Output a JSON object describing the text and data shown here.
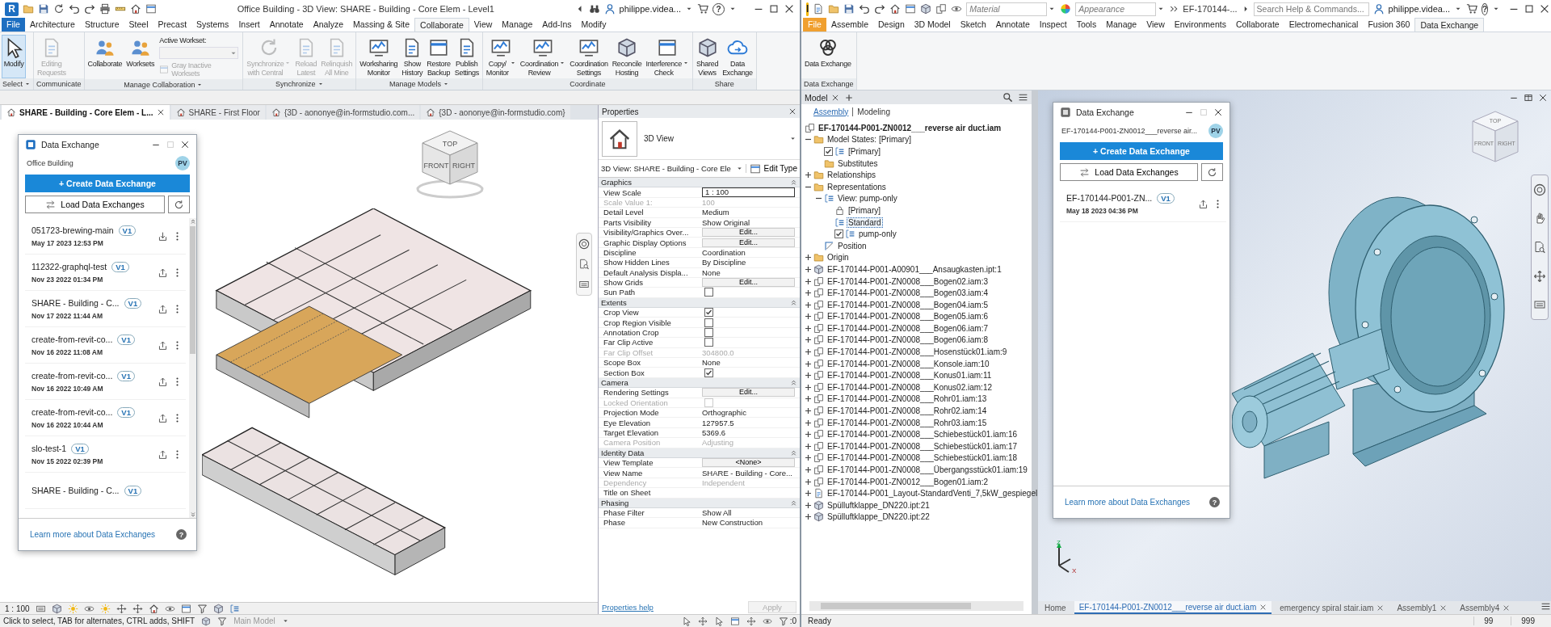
{
  "revit": {
    "logo": "R",
    "title": "Office Building - 3D View: SHARE - Building - Core Elem - Level1",
    "user": "philippe.videa...",
    "help_glyph": "?",
    "menu_tabs": [
      {
        "label": "File",
        "kind": "file",
        "selected": false
      },
      {
        "label": "Architecture",
        "kind": "tab",
        "selected": false
      },
      {
        "label": "Structure",
        "kind": "tab",
        "selected": false
      },
      {
        "label": "Steel",
        "kind": "tab",
        "selected": false
      },
      {
        "label": "Precast",
        "kind": "tab",
        "selected": false
      },
      {
        "label": "Systems",
        "kind": "tab",
        "selected": false
      },
      {
        "label": "Insert",
        "kind": "tab",
        "selected": false
      },
      {
        "label": "Annotate",
        "kind": "tab",
        "selected": false
      },
      {
        "label": "Analyze",
        "kind": "tab",
        "selected": false
      },
      {
        "label": "Massing & Site",
        "kind": "tab",
        "selected": false
      },
      {
        "label": "Collaborate",
        "kind": "tab",
        "selected": true
      },
      {
        "label": "View",
        "kind": "tab",
        "selected": false
      },
      {
        "label": "Manage",
        "kind": "tab",
        "selected": false
      },
      {
        "label": "Add-Ins",
        "kind": "tab",
        "selected": false
      },
      {
        "label": "Modify",
        "kind": "tab",
        "selected": false
      }
    ],
    "ribbon_panels": [
      {
        "label": "Select",
        "dropdown": true,
        "buttons": [
          {
            "label": "Modify",
            "selected": true,
            "disabled": false,
            "dropdown": false
          }
        ]
      },
      {
        "label": "Communicate",
        "dropdown": false,
        "buttons": [
          {
            "label": "Editing\nRequests",
            "selected": false,
            "disabled": true,
            "dropdown": false
          }
        ]
      },
      {
        "label": "Manage Collaboration",
        "dropdown": true,
        "buttons": [
          {
            "label": "Collaborate",
            "selected": false,
            "disabled": false,
            "dropdown": false
          },
          {
            "label": "Worksets",
            "selected": false,
            "disabled": false,
            "dropdown": false
          }
        ],
        "workset": {
          "label": "Active Workset:",
          "option": "Gray Inactive Worksets",
          "disabled": true
        }
      },
      {
        "label": "Synchronize",
        "dropdown": true,
        "buttons": [
          {
            "label": "Synchronize\nwith Central",
            "selected": false,
            "disabled": true,
            "dropdown": true
          },
          {
            "label": "Reload\nLatest",
            "selected": false,
            "disabled": true,
            "dropdown": false
          },
          {
            "label": "Relinquish\nAll Mine",
            "selected": false,
            "disabled": true,
            "dropdown": false
          }
        ]
      },
      {
        "label": "Manage Models",
        "dropdown": true,
        "buttons": [
          {
            "label": "Worksharing\nMonitor",
            "selected": false,
            "disabled": false,
            "dropdown": false
          },
          {
            "label": "Show\nHistory",
            "selected": false,
            "disabled": false,
            "dropdown": false
          },
          {
            "label": "Restore\nBackup",
            "selected": false,
            "disabled": false,
            "dropdown": false
          },
          {
            "label": "Publish\nSettings",
            "selected": false,
            "disabled": false,
            "dropdown": false
          }
        ]
      },
      {
        "label": "Coordinate",
        "dropdown": false,
        "buttons": [
          {
            "label": "Copy/\nMonitor",
            "selected": false,
            "disabled": false,
            "dropdown": true
          },
          {
            "label": "Coordination\nReview",
            "selected": false,
            "disabled": false,
            "dropdown": true
          },
          {
            "label": "Coordination\nSettings",
            "selected": false,
            "disabled": false,
            "dropdown": false
          },
          {
            "label": "Reconcile\nHosting",
            "selected": false,
            "disabled": false,
            "dropdown": false
          },
          {
            "label": "Interference\nCheck",
            "selected": false,
            "disabled": false,
            "dropdown": true
          }
        ]
      },
      {
        "label": "Share",
        "dropdown": false,
        "buttons": [
          {
            "label": "Shared\nViews",
            "selected": false,
            "disabled": false,
            "dropdown": false
          },
          {
            "label": "Data\nExchange",
            "selected": false,
            "disabled": false,
            "dropdown": false
          }
        ]
      }
    ],
    "view_tabs": [
      {
        "label": "SHARE - Building - Core Elem - L...",
        "selected": true
      },
      {
        "label": "SHARE - First Floor",
        "selected": false
      },
      {
        "label": "{3D - aononye@in-formstudio.com...",
        "selected": false
      },
      {
        "label": "{3D - aononye@in-formstudio.com}",
        "selected": false
      }
    ],
    "view_cube": [
      "TOP",
      "FRONT",
      "RIGHT"
    ],
    "dx": {
      "title": "Data Exchange",
      "subtitle": "Office Building",
      "avatar": "PV",
      "create": "+ Create Data Exchange",
      "load": "Load Data Exchanges",
      "footer_link": "Learn more about Data Exchanges",
      "help_glyph": "?",
      "items": [
        {
          "name": "051723-brewing-main",
          "version": "V1",
          "date": "May 17 2023 12:53 PM",
          "kind": "download"
        },
        {
          "name": "112322-graphql-test",
          "version": "V1",
          "date": "Nov 23 2022 01:34 PM",
          "kind": "upload"
        },
        {
          "name": "SHARE - Building - C...",
          "version": "V1",
          "date": "Nov 17 2022 11:44 AM",
          "kind": "upload"
        },
        {
          "name": "create-from-revit-co...",
          "version": "V1",
          "date": "Nov 16 2022 11:08 AM",
          "kind": "upload"
        },
        {
          "name": "create-from-revit-co...",
          "version": "V1",
          "date": "Nov 16 2022 10:49 AM",
          "kind": "upload"
        },
        {
          "name": "create-from-revit-co...",
          "version": "V1",
          "date": "Nov 16 2022 10:44 AM",
          "kind": "upload"
        },
        {
          "name": "slo-test-1",
          "version": "V1",
          "date": "Nov 15 2022 02:39 PM",
          "kind": "upload"
        },
        {
          "name": "SHARE - Building - C...",
          "version": "V1"
        }
      ]
    },
    "properties": {
      "title": "Properties",
      "type_name": "3D View",
      "selector": "3D View: SHARE - Building - Core Ele",
      "edit_type": "Edit Type",
      "help_link": "Properties help",
      "apply": "Apply",
      "apply_disabled": true,
      "groups": [
        {
          "label": "Graphics",
          "expanded": true,
          "rows": [
            {
              "label": "View Scale",
              "kind": "field",
              "value": "1 : 100",
              "disabled": false
            },
            {
              "label": "Scale Value    1:",
              "kind": "text",
              "value": "100",
              "disabled": true
            },
            {
              "label": "Detail Level",
              "kind": "text",
              "value": "Medium",
              "disabled": false
            },
            {
              "label": "Parts Visibility",
              "kind": "text",
              "value": "Show Original",
              "disabled": false
            },
            {
              "label": "Visibility/Graphics Over...",
              "kind": "button",
              "value": "Edit...",
              "disabled": false
            },
            {
              "label": "Graphic Display Options",
              "kind": "button",
              "value": "Edit...",
              "disabled": false
            },
            {
              "label": "Discipline",
              "kind": "text",
              "value": "Coordination",
              "disabled": false
            },
            {
              "label": "Show Hidden Lines",
              "kind": "text",
              "value": "By Discipline",
              "disabled": false
            },
            {
              "label": "Default Analysis Displa...",
              "kind": "text",
              "value": "None",
              "disabled": false
            },
            {
              "label": "Show Grids",
              "kind": "button",
              "value": "Edit...",
              "disabled": false
            },
            {
              "label": "Sun Path",
              "kind": "checkbox",
              "checked": false,
              "disabled": false
            }
          ]
        },
        {
          "label": "Extents",
          "expanded": true,
          "rows": [
            {
              "label": "Crop View",
              "kind": "checkbox",
              "checked": true,
              "disabled": false
            },
            {
              "label": "Crop Region Visible",
              "kind": "checkbox",
              "checked": false,
              "disabled": false
            },
            {
              "label": "Annotation Crop",
              "kind": "checkbox",
              "checked": false,
              "disabled": false
            },
            {
              "label": "Far Clip Active",
              "kind": "checkbox",
              "checked": false,
              "disabled": false
            },
            {
              "label": "Far Clip Offset",
              "kind": "text",
              "value": "304800.0",
              "disabled": true
            },
            {
              "label": "Scope Box",
              "kind": "text",
              "value": "None",
              "disabled": false
            },
            {
              "label": "Section Box",
              "kind": "checkbox",
              "checked": true,
              "disabled": false
            }
          ]
        },
        {
          "label": "Camera",
          "expanded": true,
          "rows": [
            {
              "label": "Rendering Settings",
              "kind": "button",
              "value": "Edit...",
              "disabled": false
            },
            {
              "label": "Locked Orientation",
              "kind": "checkbox",
              "checked": false,
              "disabled": true
            },
            {
              "label": "Projection Mode",
              "kind": "text",
              "value": "Orthographic",
              "disabled": false
            },
            {
              "label": "Eye Elevation",
              "kind": "text",
              "value": "127957.5",
              "disabled": false
            },
            {
              "label": "Target Elevation",
              "kind": "text",
              "value": "5369.6",
              "disabled": false
            },
            {
              "label": "Camera Position",
              "kind": "text",
              "value": "Adjusting",
              "disabled": true
            }
          ]
        },
        {
          "label": "Identity Data",
          "expanded": true,
          "rows": [
            {
              "label": "View Template",
              "kind": "button",
              "value": "<None>",
              "disabled": false
            },
            {
              "label": "View Name",
              "kind": "text",
              "value": "SHARE - Building - Core...",
              "disabled": false
            },
            {
              "label": "Dependency",
              "kind": "text",
              "value": "Independent",
              "disabled": true
            },
            {
              "label": "Title on Sheet",
              "kind": "text",
              "disabled": false
            }
          ]
        },
        {
          "label": "Phasing",
          "expanded": true,
          "rows": [
            {
              "label": "Phase Filter",
              "kind": "text",
              "value": "Show All",
              "disabled": false
            },
            {
              "label": "Phase",
              "kind": "text",
              "value": "New Construction",
              "disabled": false
            }
          ]
        }
      ]
    },
    "view_scale": "1 : 100",
    "status": "Click to select, TAB for alternates, CTRL adds, SHIFT",
    "model": "Main Model",
    "filter_count": ":0"
  },
  "inventor": {
    "logo": "I",
    "material_placeholder": "Material",
    "appearance_placeholder": "Appearance",
    "doc_name": "EF-170144-...",
    "search_placeholder": "Search Help & Commands...",
    "user": "philippe.videa...",
    "help_glyph": "?",
    "menu_tabs": [
      {
        "label": "File",
        "kind": "file",
        "selected": false
      },
      {
        "label": "Assemble",
        "kind": "tab",
        "selected": false
      },
      {
        "label": "Design",
        "kind": "tab",
        "selected": false
      },
      {
        "label": "3D Model",
        "kind": "tab",
        "selected": false
      },
      {
        "label": "Sketch",
        "kind": "tab",
        "selected": false
      },
      {
        "label": "Annotate",
        "kind": "tab",
        "selected": false
      },
      {
        "label": "Inspect",
        "kind": "tab",
        "selected": false
      },
      {
        "label": "Tools",
        "kind": "tab",
        "selected": false
      },
      {
        "label": "Manage",
        "kind": "tab",
        "selected": false
      },
      {
        "label": "View",
        "kind": "tab",
        "selected": false
      },
      {
        "label": "Environments",
        "kind": "tab",
        "selected": false
      },
      {
        "label": "Collaborate",
        "kind": "tab",
        "selected": false
      },
      {
        "label": "Electromechanical",
        "kind": "tab",
        "selected": false
      },
      {
        "label": "Fusion 360",
        "kind": "tab",
        "selected": false
      },
      {
        "label": "Data Exchange",
        "kind": "tab",
        "selected": true
      }
    ],
    "ribbon_panels": [
      {
        "label": "Data Exchange",
        "dropdown": false,
        "buttons": [
          {
            "label": "Data Exchange",
            "selected": false,
            "disabled": false,
            "dropdown": false
          }
        ]
      }
    ],
    "browser": {
      "tab": "Model",
      "modes": [
        {
          "label": "Assembly",
          "selected": true
        },
        {
          "label": "Modeling",
          "selected": false
        }
      ],
      "tree": {
        "label": "EF-170144-P001-ZN0012___reverse air duct.iam",
        "kind": "root",
        "selected": false,
        "children": [
          {
            "label": "Model States: [Primary]",
            "kind": "folder",
            "expanded": true,
            "selected": false,
            "children": [
              {
                "label": "[Primary]",
                "kind": "check",
                "checked": true,
                "selected": false
              },
              {
                "label": "Substitutes",
                "kind": "folder",
                "selected": false
              }
            ]
          },
          {
            "label": "Relationships",
            "kind": "folder",
            "expanded": false,
            "selected": false
          },
          {
            "label": "Representations",
            "kind": "folder",
            "expanded": true,
            "selected": false,
            "children": [
              {
                "label": "View: pump-only",
                "kind": "view",
                "expanded": true,
                "selected": false,
                "children": [
                  {
                    "label": "[Primary]",
                    "kind": "lock",
                    "selected": false
                  },
                  {
                    "label": "Standard",
                    "kind": "view",
                    "selected": true
                  },
                  {
                    "label": "pump-only",
                    "kind": "check",
                    "checked": true,
                    "selected": false
                  }
                ]
              },
              {
                "label": "Position",
                "kind": "position",
                "selected": false
              }
            ]
          },
          {
            "label": "Origin",
            "kind": "folder",
            "expanded": false,
            "selected": false
          },
          {
            "label": "EF-170144-P001-A00901___Ansaugkasten.ipt:1",
            "kind": "part",
            "expanded": false,
            "selected": false
          },
          {
            "label": "EF-170144-P001-ZN0008___Bogen02.iam:3",
            "kind": "assembly",
            "expanded": false,
            "selected": false
          },
          {
            "label": "EF-170144-P001-ZN0008___Bogen03.iam:4",
            "kind": "assembly",
            "expanded": false,
            "selected": false
          },
          {
            "label": "EF-170144-P001-ZN0008___Bogen04.iam:5",
            "kind": "assembly",
            "expanded": false,
            "selected": false
          },
          {
            "label": "EF-170144-P001-ZN0008___Bogen05.iam:6",
            "kind": "assembly",
            "expanded": false,
            "selected": false
          },
          {
            "label": "EF-170144-P001-ZN0008___Bogen06.iam:7",
            "kind": "assembly",
            "expanded": false,
            "selected": false
          },
          {
            "label": "EF-170144-P001-ZN0008___Bogen06.iam:8",
            "kind": "assembly",
            "expanded": false,
            "selected": false
          },
          {
            "label": "EF-170144-P001-ZN0008___Hosenstück01.iam:9",
            "kind": "assembly",
            "expanded": false,
            "selected": false
          },
          {
            "label": "EF-170144-P001-ZN0008___Konsole.iam:10",
            "kind": "assembly",
            "expanded": false,
            "selected": false
          },
          {
            "label": "EF-170144-P001-ZN0008___Konus01.iam:11",
            "kind": "assembly",
            "expanded": false,
            "selected": false
          },
          {
            "label": "EF-170144-P001-ZN0008___Konus02.iam:12",
            "kind": "assembly",
            "expanded": false,
            "selected": false
          },
          {
            "label": "EF-170144-P001-ZN0008___Rohr01.iam:13",
            "kind": "assembly",
            "expanded": false,
            "selected": false
          },
          {
            "label": "EF-170144-P001-ZN0008___Rohr02.iam:14",
            "kind": "assembly",
            "expanded": false,
            "selected": false
          },
          {
            "label": "EF-170144-P001-ZN0008___Rohr03.iam:15",
            "kind": "assembly",
            "expanded": false,
            "selected": false
          },
          {
            "label": "EF-170144-P001-ZN0008___Schiebestück01.iam:16",
            "kind": "assembly",
            "expanded": false,
            "selected": false
          },
          {
            "label": "EF-170144-P001-ZN0008___Schiebestück01.iam:17",
            "kind": "assembly",
            "expanded": false,
            "selected": false
          },
          {
            "label": "EF-170144-P001-ZN0008___Schiebestück01.iam:18",
            "kind": "assembly",
            "expanded": false,
            "selected": false
          },
          {
            "label": "EF-170144-P001-ZN0008___Übergangsstück01.iam:19",
            "kind": "assembly",
            "expanded": false,
            "selected": false
          },
          {
            "label": "EF-170144-P001-ZN0012___Bogen01.iam:2",
            "kind": "assembly",
            "expanded": false,
            "selected": false
          },
          {
            "label": "EF-170144-P001_Layout-StandardVenti_7,5kW_gespiegel",
            "kind": "layout",
            "expanded": false,
            "selected": false
          },
          {
            "label": "Spülluftklappe_DN220.ipt:21",
            "kind": "part",
            "expanded": false,
            "selected": false
          },
          {
            "label": "Spülluftklappe_DN220.ipt:22",
            "kind": "part",
            "expanded": false,
            "selected": false
          }
        ]
      }
    },
    "dx": {
      "title": "Data Exchange",
      "subtitle": "EF-170144-P001-ZN0012___reverse air...",
      "avatar": "PV",
      "create": "+ Create Data Exchange",
      "load": "Load Data Exchanges",
      "footer_link": "Learn more about Data Exchanges",
      "help_glyph": "?",
      "items": [
        {
          "name": "EF-170144-P001-ZN...",
          "version": "V1",
          "date": "May 18 2023 04:36 PM",
          "kind": "upload"
        }
      ]
    },
    "view_cube": [
      "TOP",
      "FRONT",
      "RIGHT"
    ],
    "axis_labels": [
      "Z",
      "X"
    ],
    "doc_tabs": [
      {
        "label": "Home",
        "selected": false,
        "closable": false
      },
      {
        "label": "EF-170144-P001-ZN0012___reverse air duct.iam",
        "selected": true,
        "closable": true
      },
      {
        "label": "emergency spiral stair.iam",
        "selected": false,
        "closable": true
      },
      {
        "label": "Assembly1",
        "selected": false,
        "closable": true
      },
      {
        "label": "Assembly4",
        "selected": false,
        "closable": true
      }
    ],
    "status": "Ready",
    "counts": [
      "99",
      "999"
    ]
  }
}
